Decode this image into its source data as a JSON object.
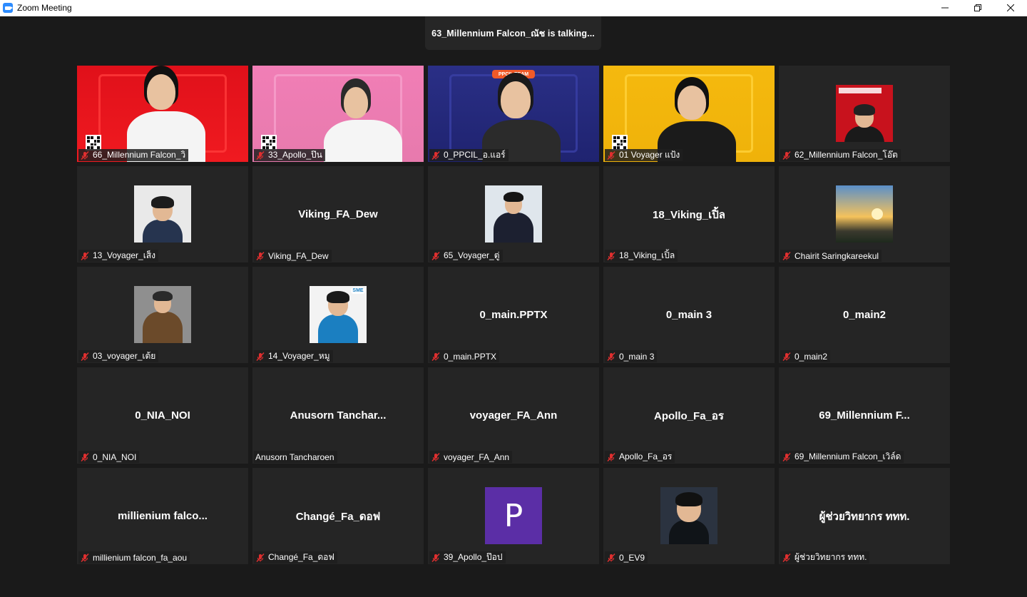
{
  "window": {
    "title": "Zoom Meeting",
    "controls": {
      "minimize": "minimize-icon",
      "restore": "restore-icon",
      "close": "close-icon"
    }
  },
  "talking_banner": "63_Millennium  Falcon_ณัช is  talking...",
  "colors": {
    "background": "#1a1a1a",
    "tile": "#252525",
    "mute": "#e02f2f",
    "avatar_letter_bg": "#5b2ea6"
  },
  "tiles": [
    {
      "name": "66_Millennium Falcon_วิ",
      "kind": "video",
      "theme": "red",
      "muted": true
    },
    {
      "name": "33_Apollo_ป๊น",
      "kind": "video",
      "theme": "pink",
      "muted": true
    },
    {
      "name": "0_PPCIL_อ.แอร์",
      "kind": "video",
      "theme": "blue",
      "banner": "PPCIL TEAM",
      "muted": true
    },
    {
      "name": "01 Voyager แป้ง",
      "kind": "video",
      "theme": "yellow",
      "muted": true
    },
    {
      "name": "62_Millennium Falcon_โอ๊ต",
      "kind": "photo",
      "photo": "red",
      "muted": true
    },
    {
      "name": "13_Voyager_เส็ง",
      "kind": "photo",
      "photo": "suit-light",
      "muted": true
    },
    {
      "name": "Viking_FA_Dew",
      "kind": "text",
      "display": "Viking_FA_Dew",
      "muted": true
    },
    {
      "name": "65_Voyager_ตู่",
      "kind": "photo",
      "photo": "suit-blue",
      "muted": true
    },
    {
      "name": "18_Viking_เปิ้ล",
      "kind": "text",
      "display": "18_Viking_เปิ้ล",
      "muted": true
    },
    {
      "name": "Chairit Saringkareekul",
      "kind": "photo",
      "photo": "landscape",
      "muted": true
    },
    {
      "name": "03_voyager_เต้ย",
      "kind": "photo",
      "photo": "uniform",
      "muted": true
    },
    {
      "name": "14_Voyager_หมู",
      "kind": "photo",
      "photo": "sme",
      "badge": "SME",
      "muted": true
    },
    {
      "name": "0_main.PPTX",
      "kind": "text",
      "display": "0_main.PPTX",
      "muted": true
    },
    {
      "name": "0_main 3",
      "kind": "text",
      "display": "0_main 3",
      "muted": true
    },
    {
      "name": "0_main2",
      "kind": "text",
      "display": "0_main2",
      "muted": true
    },
    {
      "name": "0_NIA_NOI",
      "kind": "text",
      "display": "0_NIA_NOI",
      "muted": true
    },
    {
      "name": "Anusorn Tancharoen",
      "kind": "text",
      "display": "Anusorn  Tanchar...",
      "muted": false
    },
    {
      "name": "voyager_FA_Ann",
      "kind": "text",
      "display": "voyager_FA_Ann",
      "muted": true
    },
    {
      "name": "Apollo_Fa_อร",
      "kind": "text",
      "display": "Apollo_Fa_อร",
      "muted": true
    },
    {
      "name": "69_Millennium Falcon_เวิล์ด",
      "kind": "text",
      "display": "69_Millennium  F...",
      "muted": true
    },
    {
      "name": "millienium falcon_fa_aou",
      "kind": "text",
      "display": "millienium  falco...",
      "muted": true
    },
    {
      "name": "Changé_Fa_ดอฟ",
      "kind": "text",
      "display": "Changé_Fa_ดอฟ",
      "muted": true
    },
    {
      "name": "39_Apollo_ป๊อป",
      "kind": "letter",
      "letter": "P",
      "muted": true
    },
    {
      "name": "0_EV9",
      "kind": "photo",
      "photo": "man-dark",
      "muted": true
    },
    {
      "name": "ผู้ช่วยวิทยากร ททท.",
      "kind": "text",
      "display": "ผู้ช่วยวิทยากร  ททท.",
      "muted": true
    }
  ]
}
